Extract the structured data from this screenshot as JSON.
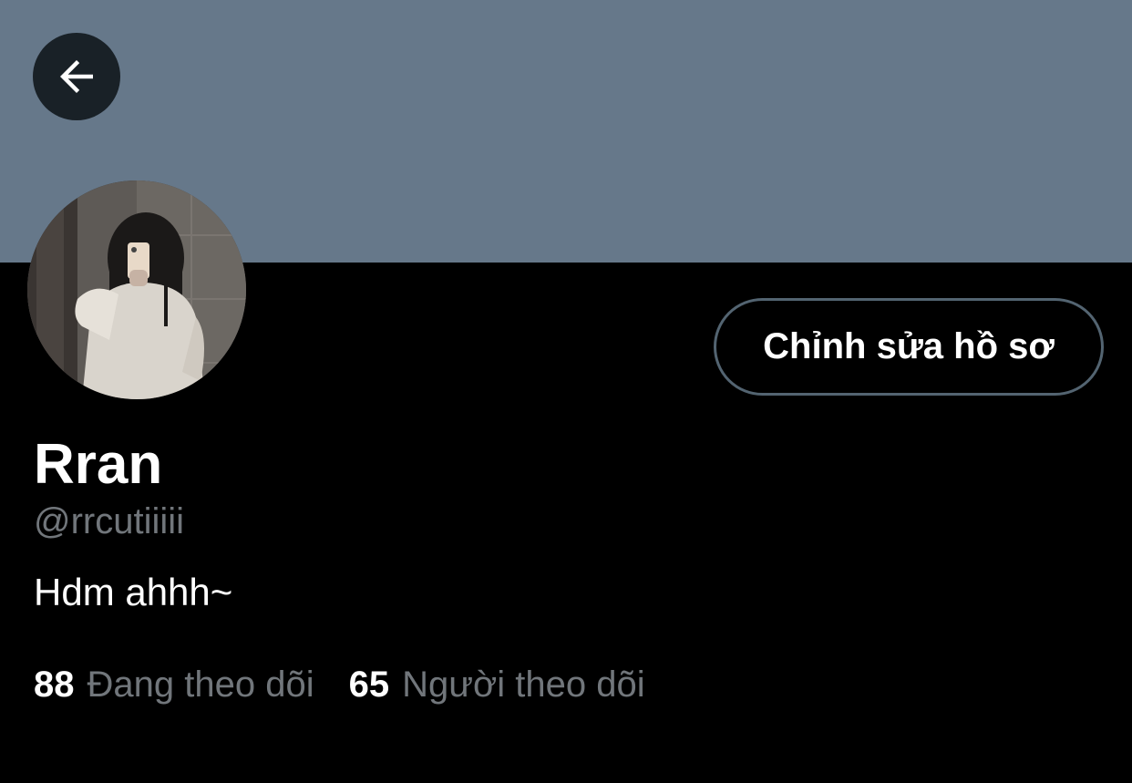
{
  "header": {
    "banner_color": "#66788a",
    "back_icon": "arrow-left-icon"
  },
  "profile": {
    "avatar_icon": "profile-photo",
    "edit_button_label": "Chỉnh sửa hồ sơ",
    "display_name": "Rran",
    "handle": "@rrcutiiiii",
    "bio": "Hdm ahhh~"
  },
  "stats": {
    "following_count": "88",
    "following_label": "Đang theo dõi",
    "followers_count": "65",
    "followers_label": "Người theo dõi"
  },
  "colors": {
    "background": "#000000",
    "primary_text": "#ffffff",
    "secondary_text": "#71767b",
    "button_border": "#536471"
  }
}
